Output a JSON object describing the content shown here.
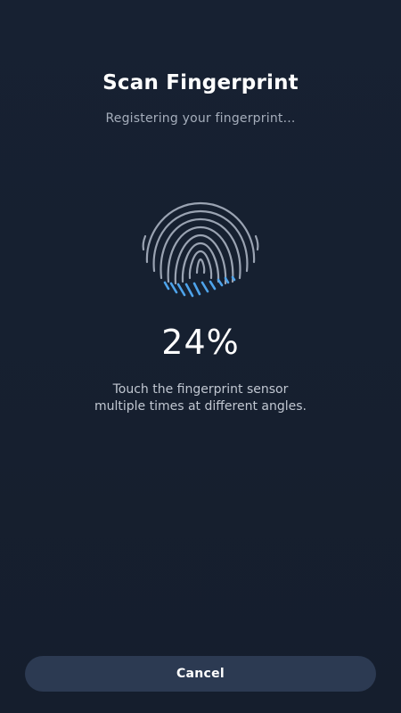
{
  "header": {
    "title": "Scan Fingerprint",
    "subtitle": "Registering your fingerprint..."
  },
  "scanner": {
    "icon": "fingerprint-icon",
    "progress_percent": 24,
    "progress_text": "24%",
    "instructions_line1": "Touch the fingerprint sensor",
    "instructions_line2": "multiple times at different angles."
  },
  "actions": {
    "cancel_label": "Cancel"
  },
  "colors": {
    "background": "#161f2f",
    "fingerprint_idle": "#9aa3b2",
    "fingerprint_scanned": "#4ea3ea",
    "button_bg": "#2c3a52"
  }
}
